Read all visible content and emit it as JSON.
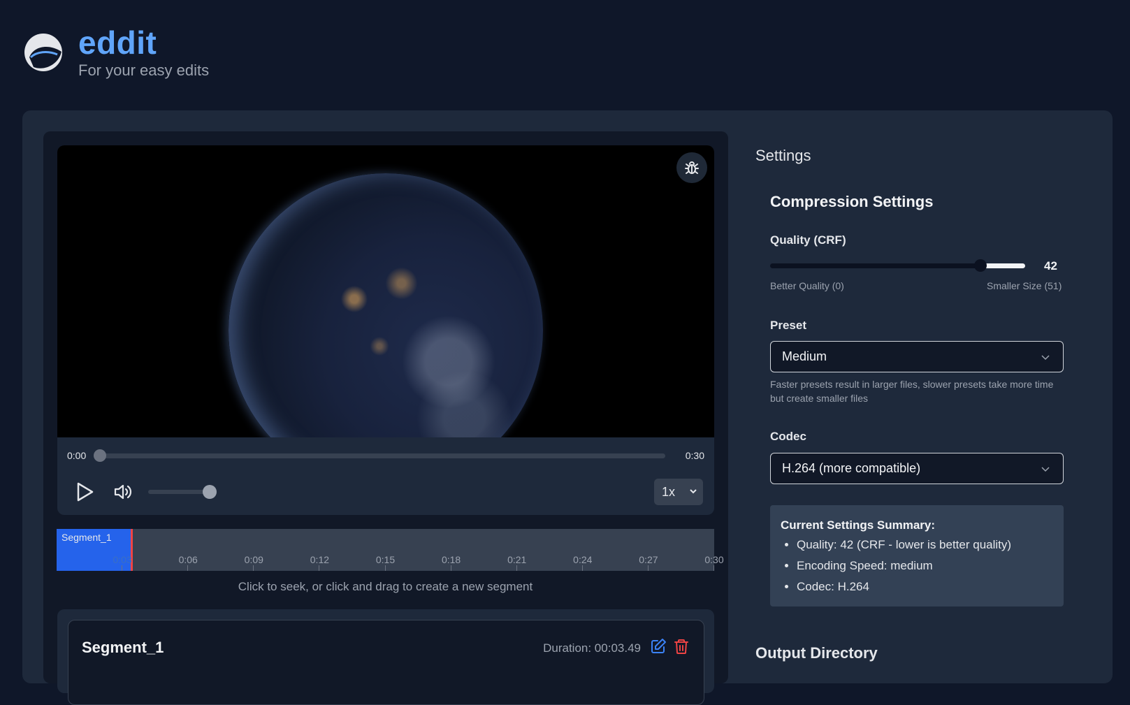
{
  "app": {
    "name": "eddit",
    "tagline": "For your easy edits"
  },
  "player": {
    "current_time": "0:00",
    "total_time": "0:30",
    "progress": 0,
    "volume": 1.0,
    "speed": "1x",
    "debug_icon": "bug-icon"
  },
  "timeline": {
    "segment_label": "Segment_1",
    "ticks": [
      "0:03",
      "0:06",
      "0:09",
      "0:12",
      "0:15",
      "0:18",
      "0:21",
      "0:24",
      "0:27",
      "0:30"
    ],
    "hint": "Click to seek, or click and drag to create a new segment"
  },
  "segments": [
    {
      "name": "Segment_1",
      "duration": "Duration: 00:03.49"
    }
  ],
  "settings": {
    "title": "Settings",
    "compression_title": "Compression Settings",
    "quality_label": "Quality (CRF)",
    "quality_value": "42",
    "quality_min_label": "Better Quality (0)",
    "quality_max_label": "Smaller Size (51)",
    "quality_min": 0,
    "quality_max": 51,
    "preset_label": "Preset",
    "preset_value": "Medium",
    "preset_help": "Faster presets result in larger files, slower presets take more time but create smaller files",
    "codec_label": "Codec",
    "codec_value": "H.264 (more compatible)",
    "summary_title": "Current Settings Summary:",
    "summary_items": [
      "Quality: 42 (CRF - lower is better quality)",
      "Encoding Speed: medium",
      "Codec: H.264"
    ],
    "output_dir_title": "Output Directory"
  },
  "colors": {
    "accent": "#60a5fa",
    "segment": "#2563eb",
    "playhead": "#ef4444",
    "delete": "#ef4444"
  }
}
